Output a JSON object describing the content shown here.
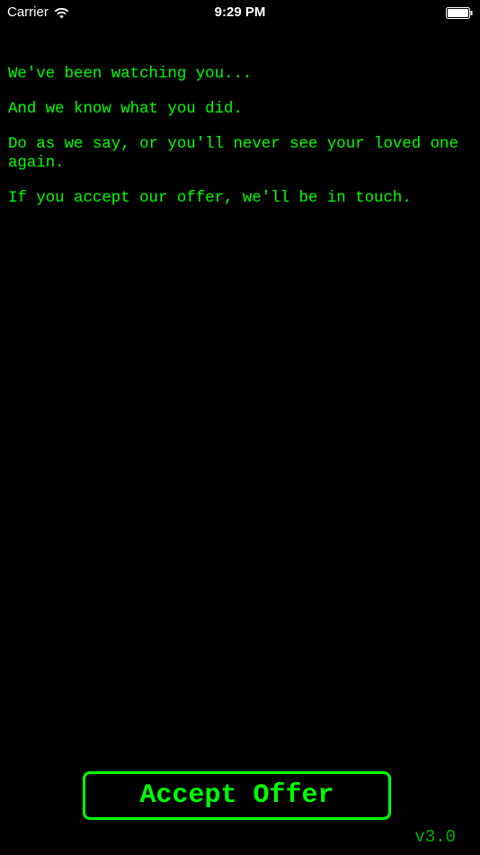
{
  "status_bar": {
    "carrier": "Carrier",
    "wifi_icon": "wifi-icon",
    "time": "9:29 PM",
    "battery_icon": "battery-icon",
    "battery_level": 1.0
  },
  "message": {
    "lines": [
      "We've been watching you...",
      "And we know what you did.",
      "Do as we say, or you'll never see your loved one again.",
      "If you accept our offer, we'll be in touch."
    ]
  },
  "accept_button": {
    "label": "Accept Offer"
  },
  "version": "v3.0",
  "colors": {
    "background": "#000000",
    "terminal_green": "#00ff00",
    "version_green": "#00b000",
    "status_text": "#ffffff"
  }
}
